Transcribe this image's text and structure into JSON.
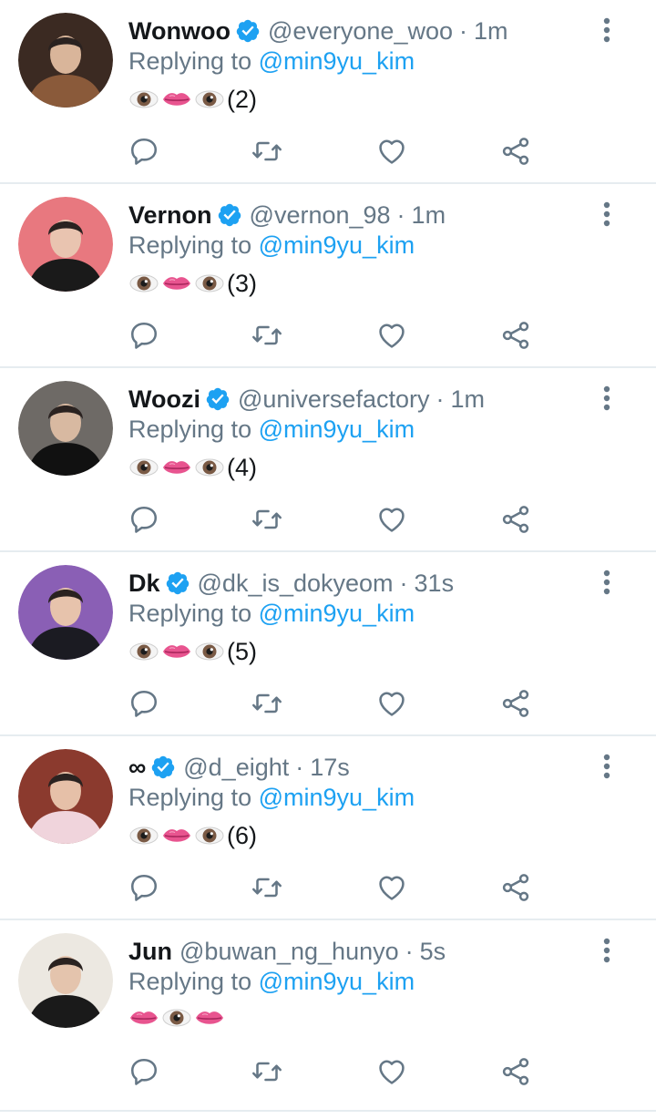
{
  "colors": {
    "link": "#1da1f2",
    "muted": "#657786",
    "text": "#14171a",
    "divider": "#e6ecf0"
  },
  "reply_prefix": "Replying to",
  "tweets": [
    {
      "name": "Wonwoo",
      "verified": true,
      "handle": "@everyone_woo",
      "time": "1m",
      "mention": "@min9yu_kim",
      "emoji": [
        "eyes-emoji",
        "lips-emoji",
        "eyes-emoji"
      ],
      "suffix": "(2)",
      "avatar_colors": [
        "#3b2a22",
        "#8a5a3a",
        "#d9b59a"
      ]
    },
    {
      "name": "Vernon",
      "verified": true,
      "handle": "@vernon_98",
      "time": "1m",
      "mention": "@min9yu_kim",
      "emoji": [
        "eyes-emoji",
        "lips-emoji",
        "eyes-emoji"
      ],
      "suffix": "(3)",
      "avatar_colors": [
        "#e8787f",
        "#1a1a1a",
        "#e9c4b0"
      ]
    },
    {
      "name": "Woozi",
      "verified": true,
      "handle": "@universefactory",
      "time": "1m",
      "mention": "@min9yu_kim",
      "emoji": [
        "eyes-emoji",
        "lips-emoji",
        "eyes-emoji"
      ],
      "suffix": "(4)",
      "avatar_colors": [
        "#6e6a66",
        "#111111",
        "#d8b9a1"
      ]
    },
    {
      "name": "Dk",
      "verified": true,
      "handle": "@dk_is_dokyeom",
      "time": "31s",
      "mention": "@min9yu_kim",
      "emoji": [
        "eyes-emoji",
        "lips-emoji",
        "eyes-emoji"
      ],
      "suffix": "(5)",
      "avatar_colors": [
        "#8a5fb5",
        "#1b1b22",
        "#e7c3ac"
      ]
    },
    {
      "name": "∞",
      "verified": true,
      "handle": "@d_eight",
      "time": "17s",
      "mention": "@min9yu_kim",
      "emoji": [
        "eyes-emoji",
        "lips-emoji",
        "eyes-emoji"
      ],
      "suffix": "(6)",
      "avatar_colors": [
        "#8b3a2e",
        "#f0d4dc",
        "#e6c0a8"
      ]
    },
    {
      "name": "Jun",
      "verified": false,
      "handle": "@buwan_ng_hunyo",
      "time": "5s",
      "mention": "@min9yu_kim",
      "emoji": [
        "lips-emoji",
        "eyes-emoji",
        "lips-emoji"
      ],
      "suffix": "",
      "avatar_colors": [
        "#ece8e1",
        "#1a1a1a",
        "#e4c4ad"
      ]
    }
  ]
}
